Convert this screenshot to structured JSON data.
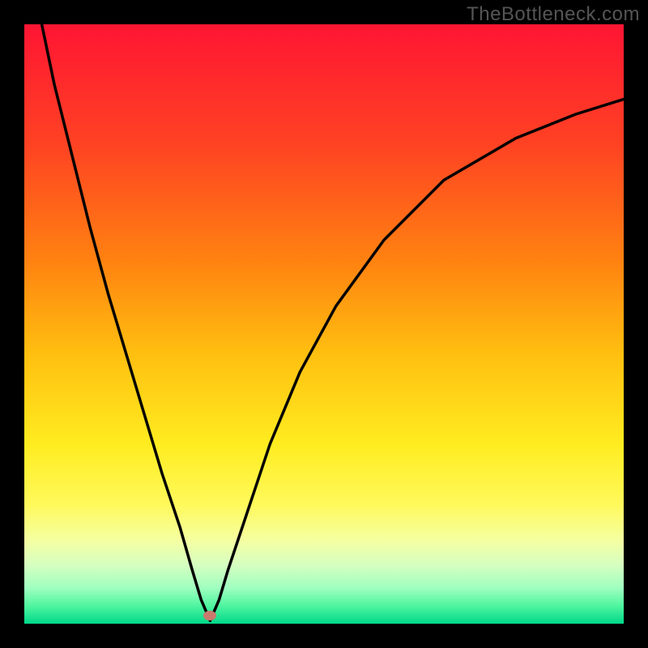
{
  "watermark": "TheBottleneck.com",
  "chart_data": {
    "type": "line",
    "title": "",
    "xlabel": "",
    "ylabel": "",
    "xlim": [
      0,
      1
    ],
    "ylim": [
      0,
      1
    ],
    "x_min_point": 0.31,
    "marker": {
      "x": 0.31,
      "y": 0.014,
      "color": "#c97a6d"
    },
    "series": [
      {
        "name": "curve",
        "color": "#000000",
        "x": [
          0.025,
          0.05,
          0.08,
          0.11,
          0.14,
          0.17,
          0.2,
          0.23,
          0.26,
          0.28,
          0.295,
          0.31,
          0.325,
          0.34,
          0.37,
          0.41,
          0.46,
          0.52,
          0.6,
          0.7,
          0.82,
          0.92,
          1.0
        ],
        "y": [
          1.02,
          0.9,
          0.78,
          0.66,
          0.55,
          0.45,
          0.35,
          0.25,
          0.16,
          0.09,
          0.04,
          0.005,
          0.04,
          0.09,
          0.18,
          0.3,
          0.42,
          0.53,
          0.64,
          0.74,
          0.81,
          0.85,
          0.875
        ]
      }
    ],
    "background_gradient": {
      "stops": [
        {
          "offset": 0.0,
          "color": "#ff1533"
        },
        {
          "offset": 0.2,
          "color": "#ff4223"
        },
        {
          "offset": 0.4,
          "color": "#ff8410"
        },
        {
          "offset": 0.55,
          "color": "#ffbf10"
        },
        {
          "offset": 0.7,
          "color": "#ffec20"
        },
        {
          "offset": 0.8,
          "color": "#fff95a"
        },
        {
          "offset": 0.86,
          "color": "#f5ffa0"
        },
        {
          "offset": 0.9,
          "color": "#d8ffc0"
        },
        {
          "offset": 0.94,
          "color": "#a0ffc0"
        },
        {
          "offset": 0.97,
          "color": "#50f5a0"
        },
        {
          "offset": 1.0,
          "color": "#00d88a"
        }
      ]
    }
  }
}
